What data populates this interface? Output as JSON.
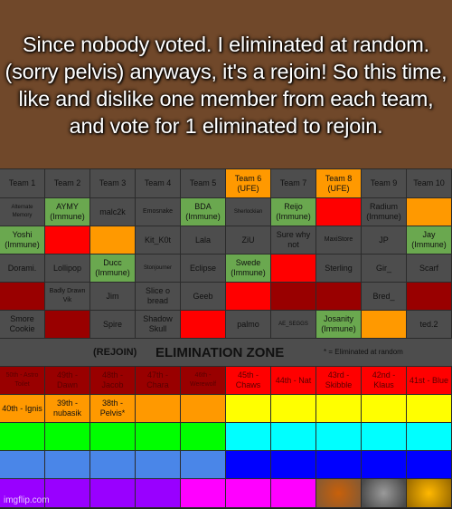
{
  "caption": "Since nobody voted. I eliminated at random. (sorry pelvis) anyways, it's a rejoin! So this time, like and dislike one member from each team, and vote for 1 eliminated to rejoin.",
  "colors": {
    "background": "#70482a",
    "cell_default": "#4d4d4d",
    "immune": "#6aa84f",
    "red": "#ff0000",
    "dark_red": "#990000",
    "orange": "#ff9900"
  },
  "teams": [
    {
      "label": "Team 1",
      "color": "gray"
    },
    {
      "label": "Team 2",
      "color": "gray"
    },
    {
      "label": "Team 3",
      "color": "gray"
    },
    {
      "label": "Team 4",
      "color": "gray"
    },
    {
      "label": "Team 5",
      "color": "gray"
    },
    {
      "label": "Team 6 (UFE)",
      "color": "orange"
    },
    {
      "label": "Team 7",
      "color": "gray"
    },
    {
      "label": "Team 8 (UFE)",
      "color": "orange"
    },
    {
      "label": "Team 9",
      "color": "gray"
    },
    {
      "label": "Team 10",
      "color": "gray"
    }
  ],
  "rows": [
    [
      {
        "text": "Alternate Memory",
        "color": "gray",
        "size": "tiny"
      },
      {
        "text": "AYMY (Immune)",
        "color": "green"
      },
      {
        "text": "malc2k",
        "color": "gray"
      },
      {
        "text": "Emosnake",
        "color": "gray",
        "size": "small"
      },
      {
        "text": "BDA (Immune)",
        "color": "green"
      },
      {
        "text": "Sherlockian",
        "color": "gray",
        "size": "tiny"
      },
      {
        "text": "Reijo (Immune)",
        "color": "green"
      },
      {
        "text": "",
        "color": "red"
      },
      {
        "text": "Radium (Immune)",
        "color": "gray"
      },
      {
        "text": "",
        "color": "orange"
      }
    ],
    [
      {
        "text": "Yoshi (Immune)",
        "color": "green"
      },
      {
        "text": "",
        "color": "red"
      },
      {
        "text": "",
        "color": "orange"
      },
      {
        "text": "Kit_K0t",
        "color": "gray"
      },
      {
        "text": "Lala",
        "color": "gray"
      },
      {
        "text": "ZiU",
        "color": "gray"
      },
      {
        "text": "Sure why not",
        "color": "gray"
      },
      {
        "text": "MaxiStore",
        "color": "gray",
        "size": "small"
      },
      {
        "text": "JP",
        "color": "gray"
      },
      {
        "text": "Jay (Immune)",
        "color": "green"
      }
    ],
    [
      {
        "text": "Dorami.",
        "color": "gray"
      },
      {
        "text": "Lollipop",
        "color": "gray"
      },
      {
        "text": "Ducc (Immune)",
        "color": "green"
      },
      {
        "text": "Stonjourner",
        "color": "gray",
        "size": "tiny"
      },
      {
        "text": "Eclipse",
        "color": "gray"
      },
      {
        "text": "Swede (Immune)",
        "color": "green"
      },
      {
        "text": "",
        "color": "red"
      },
      {
        "text": "Sterling",
        "color": "gray"
      },
      {
        "text": "Gir_",
        "color": "gray"
      },
      {
        "text": "Scarf",
        "color": "gray"
      }
    ],
    [
      {
        "text": "",
        "color": "darkred"
      },
      {
        "text": "Badly Drawn Vik",
        "color": "gray",
        "size": "small"
      },
      {
        "text": "Jim",
        "color": "gray"
      },
      {
        "text": "Slice o bread",
        "color": "gray"
      },
      {
        "text": "Geeb",
        "color": "gray"
      },
      {
        "text": "",
        "color": "red"
      },
      {
        "text": "",
        "color": "darkred"
      },
      {
        "text": "",
        "color": "darkred"
      },
      {
        "text": "Bred_",
        "color": "gray"
      },
      {
        "text": "",
        "color": "darkred"
      }
    ],
    [
      {
        "text": "Smore Cookie",
        "color": "gray"
      },
      {
        "text": "",
        "color": "darkred"
      },
      {
        "text": "Spire",
        "color": "gray"
      },
      {
        "text": "Shadow Skull",
        "color": "gray"
      },
      {
        "text": "",
        "color": "red"
      },
      {
        "text": "palmo",
        "color": "gray"
      },
      {
        "text": "AE_SEGGS",
        "color": "gray",
        "size": "tiny"
      },
      {
        "text": "Josanity (Immune)",
        "color": "green"
      },
      {
        "text": "",
        "color": "orange"
      },
      {
        "text": "ted.2",
        "color": "gray"
      }
    ]
  ],
  "elimination_zone": {
    "rejoin_label": "(REJOIN)",
    "title": "ELIMINATION ZONE",
    "note": "* = Eliminated at random"
  },
  "eliminated_rows": [
    [
      {
        "text": "50th - Astro Toilet",
        "color": "darkred",
        "size": "small"
      },
      {
        "text": "49th - Dawn",
        "color": "darkred"
      },
      {
        "text": "48th - Jacob",
        "color": "darkred"
      },
      {
        "text": "47th - Chara",
        "color": "darkred"
      },
      {
        "text": "46th - Werewolf",
        "color": "darkred",
        "size": "small"
      },
      {
        "text": "45th - Chaws",
        "color": "red"
      },
      {
        "text": "44th - Nat",
        "color": "red"
      },
      {
        "text": "43rd - Skibble",
        "color": "red"
      },
      {
        "text": "42nd - Klaus",
        "color": "red"
      },
      {
        "text": "41st - Blue",
        "color": "red"
      }
    ],
    [
      {
        "text": "40th - Ignis",
        "color": "orange"
      },
      {
        "text": "39th - nubasik",
        "color": "orange"
      },
      {
        "text": "38th - Pelvis*",
        "color": "orange"
      },
      {
        "text": "",
        "color": "orange"
      },
      {
        "text": "",
        "color": "orange"
      },
      {
        "text": "",
        "color": "yellow"
      },
      {
        "text": "",
        "color": "yellow"
      },
      {
        "text": "",
        "color": "yellow"
      },
      {
        "text": "",
        "color": "yellow"
      },
      {
        "text": "",
        "color": "yellow"
      }
    ],
    [
      {
        "text": "",
        "color": "lime"
      },
      {
        "text": "",
        "color": "lime"
      },
      {
        "text": "",
        "color": "lime"
      },
      {
        "text": "",
        "color": "lime"
      },
      {
        "text": "",
        "color": "lime"
      },
      {
        "text": "",
        "color": "cyan"
      },
      {
        "text": "",
        "color": "cyan"
      },
      {
        "text": "",
        "color": "cyan"
      },
      {
        "text": "",
        "color": "cyan"
      },
      {
        "text": "",
        "color": "cyan"
      }
    ],
    [
      {
        "text": "",
        "color": "lblue"
      },
      {
        "text": "",
        "color": "lblue"
      },
      {
        "text": "",
        "color": "lblue"
      },
      {
        "text": "",
        "color": "lblue"
      },
      {
        "text": "",
        "color": "lblue"
      },
      {
        "text": "",
        "color": "blue"
      },
      {
        "text": "",
        "color": "blue"
      },
      {
        "text": "",
        "color": "blue"
      },
      {
        "text": "",
        "color": "blue"
      },
      {
        "text": "",
        "color": "blue"
      }
    ],
    [
      {
        "text": "",
        "color": "purple"
      },
      {
        "text": "",
        "color": "purple"
      },
      {
        "text": "",
        "color": "purple"
      },
      {
        "text": "",
        "color": "purple"
      },
      {
        "text": "",
        "color": "magenta"
      },
      {
        "text": "",
        "color": "magenta"
      },
      {
        "text": "",
        "color": "magenta"
      },
      {
        "text": "",
        "color": "bronze"
      },
      {
        "text": "",
        "color": "silver"
      },
      {
        "text": "",
        "color": "gold"
      }
    ]
  ],
  "watermark": "imgflip.com"
}
